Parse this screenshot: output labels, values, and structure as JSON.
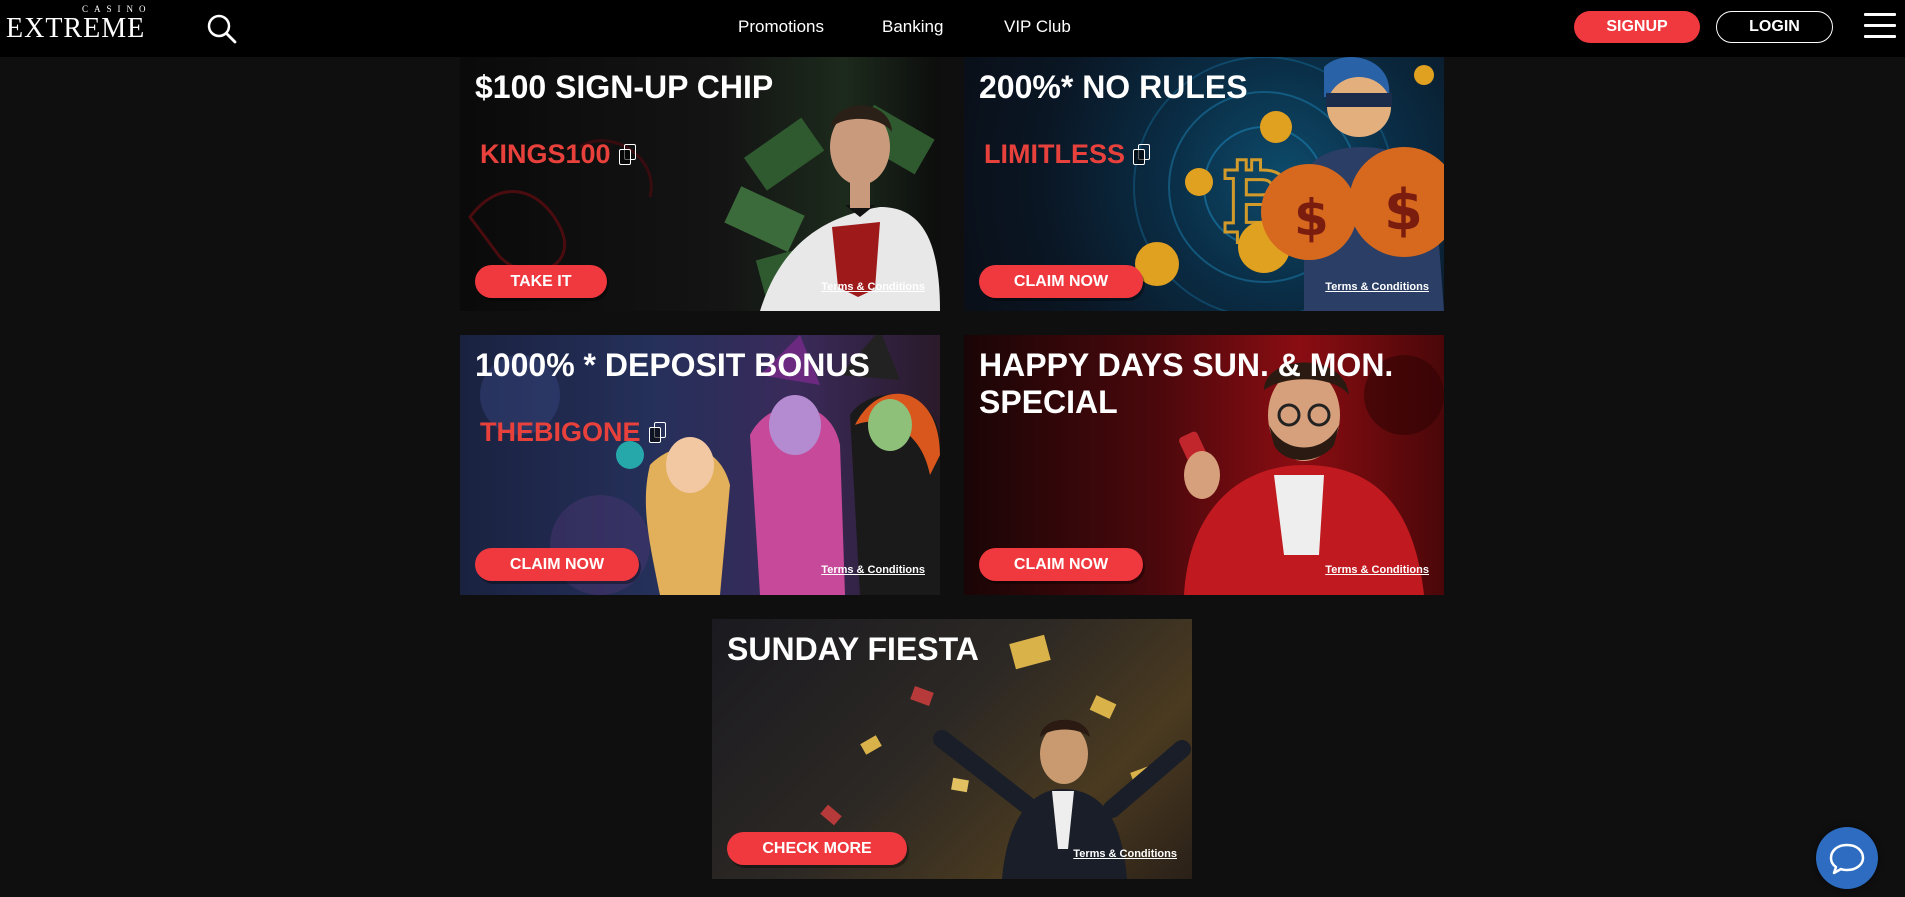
{
  "header": {
    "logo_small": "CASINO",
    "logo_big": "EXTREME",
    "nav": [
      {
        "label": "Promotions"
      },
      {
        "label": "Banking"
      },
      {
        "label": "VIP Club"
      }
    ],
    "signup_label": "SIGNUP",
    "login_label": "LOGIN"
  },
  "promos": [
    {
      "title": "$100 SIGN-UP CHIP",
      "code": "KINGS100",
      "cta": "TAKE IT",
      "terms": "Terms & Conditions"
    },
    {
      "title": "200%* NO RULES",
      "code": "LIMITLESS",
      "cta": "CLAIM NOW",
      "terms": "Terms & Conditions"
    },
    {
      "title": "1000% * DEPOSIT BONUS",
      "code": "THEBIGONE",
      "cta": "CLAIM NOW",
      "terms": "Terms & Conditions"
    },
    {
      "title_line1": "HAPPY DAYS SUN. & MON.",
      "title_line2": "SPECIAL",
      "cta": "CLAIM NOW",
      "terms": "Terms & Conditions"
    },
    {
      "title": "SUNDAY FIESTA",
      "cta": "CHECK MORE",
      "terms": "Terms & Conditions"
    }
  ],
  "icons": {
    "search": "search-icon",
    "menu": "hamburger-menu-icon",
    "copy": "copy-icon",
    "chat": "chat-bubble-icon"
  },
  "colors": {
    "accent": "#f0393f",
    "code": "#e8413c",
    "background": "#0f0f10",
    "header": "#000000",
    "chat": "#2d6cc0"
  }
}
